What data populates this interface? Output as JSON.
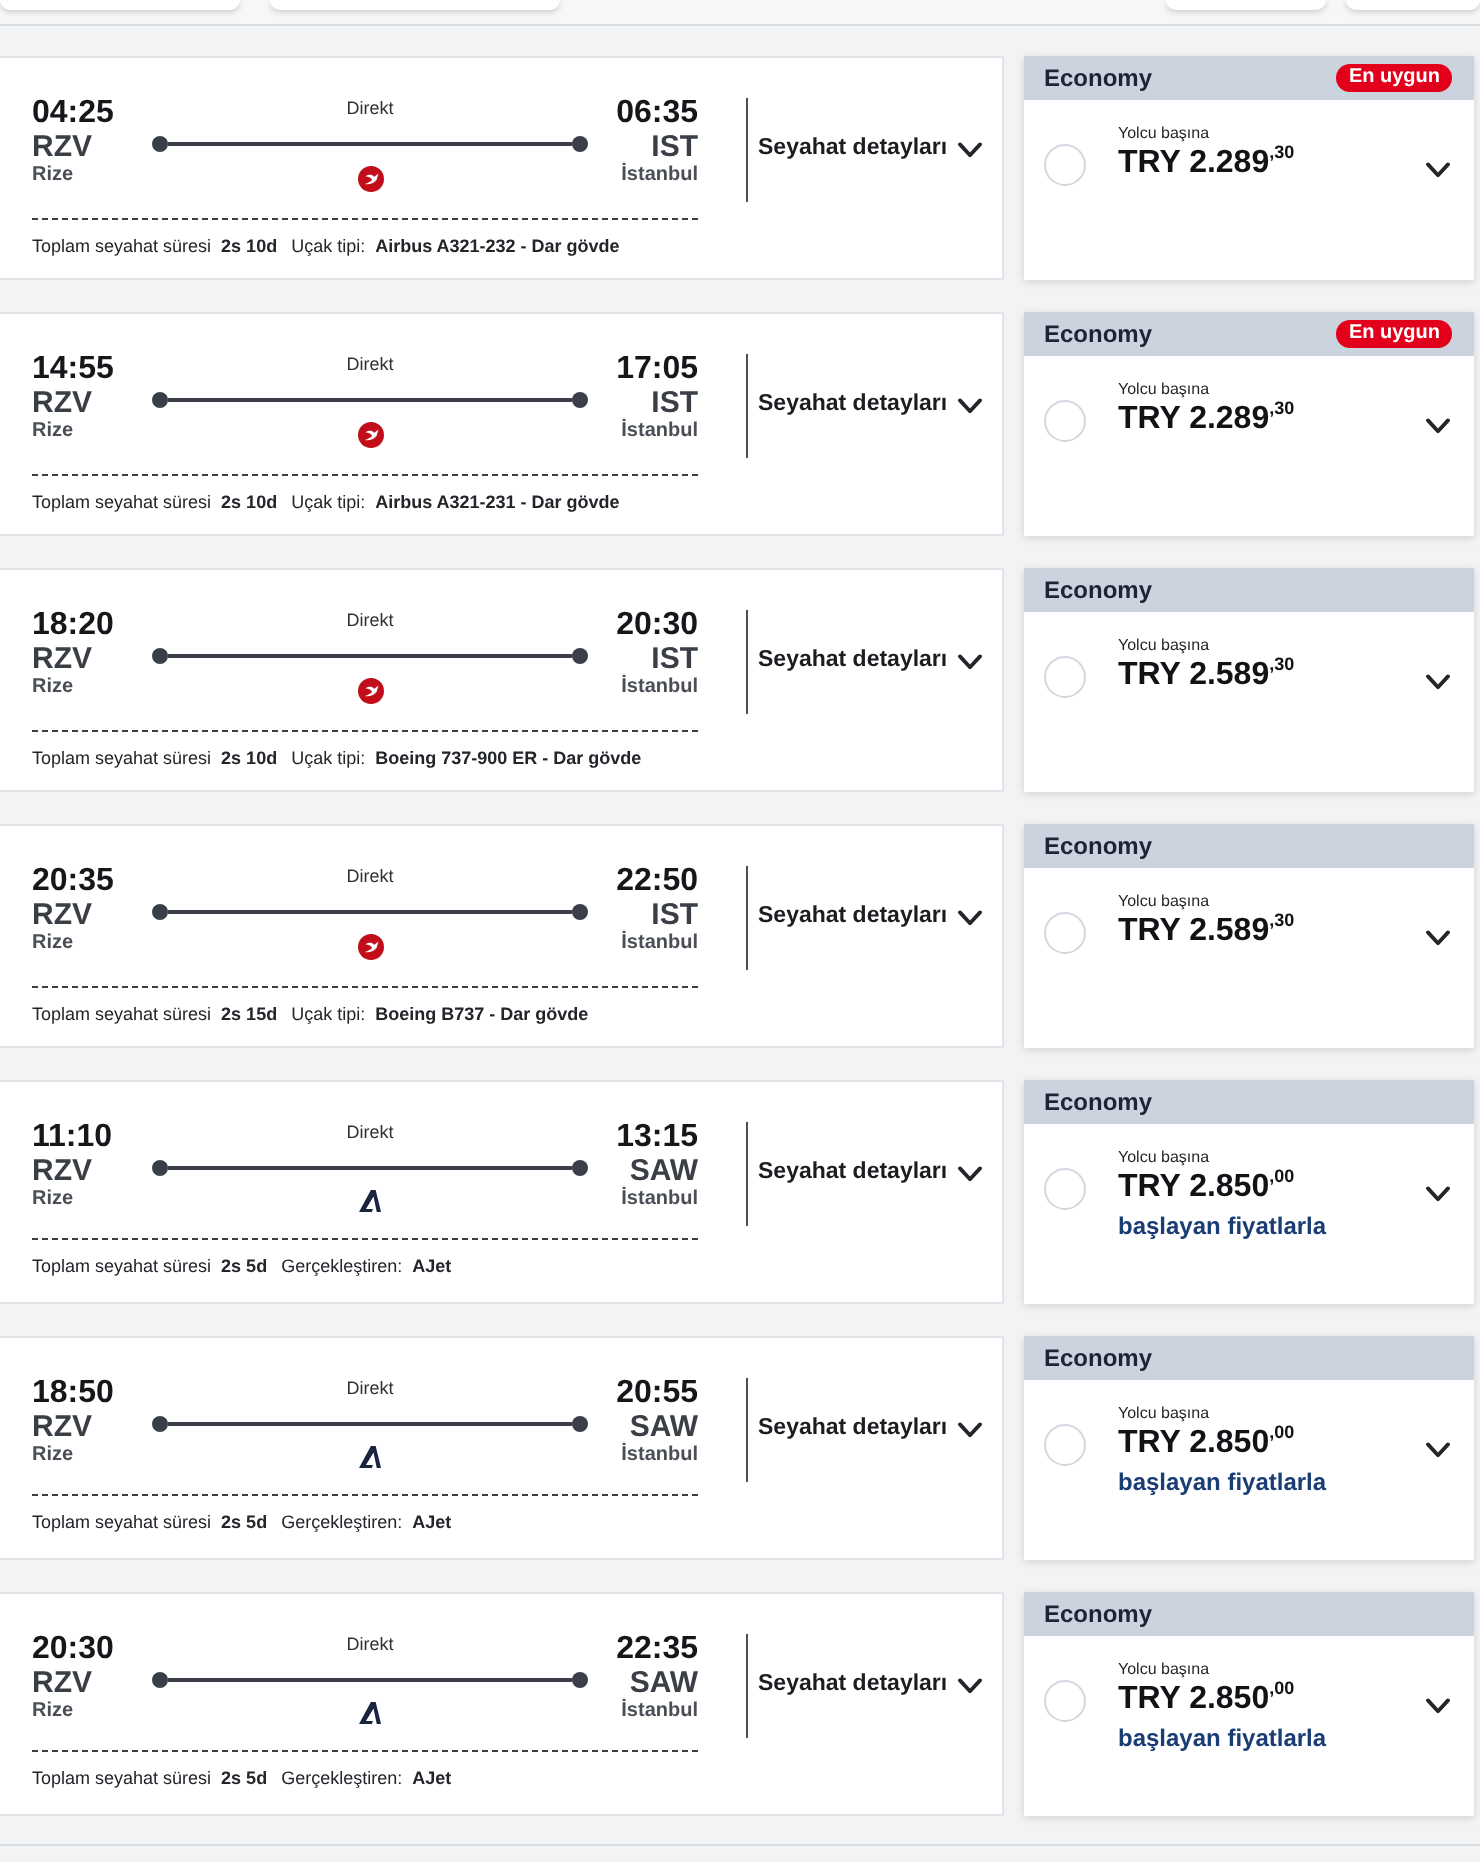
{
  "flights": [
    {
      "departure": {
        "time": "04:25",
        "code": "RZV",
        "city": "Rize"
      },
      "stop_label": "Direkt",
      "logo": {
        "kind": "disc"
      },
      "arrival": {
        "time": "06:35",
        "code": "IST",
        "city": "İstanbul"
      },
      "duration_label": "Toplam seyahat süresi",
      "duration": "2s 10d",
      "info_label": "Uçak tipi:",
      "info_value": "Airbus A321-232 - Dar gövde",
      "details_button": "Seyahat detayları",
      "fare": {
        "cabin": "Economy",
        "badge": "En uygun",
        "caption": "Yolcu başına",
        "price": "TRY 2.289$^{,30}$",
        "selected": false
      }
    },
    {
      "departure": {
        "time": "14:55",
        "code": "RZV",
        "city": "Rize"
      },
      "stop_label": "Direkt",
      "logo": {
        "kind": "disc"
      },
      "arrival": {
        "time": "17:05",
        "code": "IST",
        "city": "İstanbul"
      },
      "duration_label": "Toplam seyahat süresi",
      "duration": "2s 10d",
      "info_label": "Uçak tipi:",
      "info_value": "Airbus A321-231 - Dar gövde",
      "details_button": "Seyahat detayları",
      "fare": {
        "cabin": "Economy",
        "badge": "En uygun",
        "caption": "Yolcu başına",
        "price": "TRY 2.289$^{,30}$",
        "selected": false
      }
    },
    {
      "departure": {
        "time": "18:20",
        "code": "RZV",
        "city": "Rize"
      },
      "stop_label": "Direkt",
      "logo": {
        "kind": "disc"
      },
      "arrival": {
        "time": "20:30",
        "code": "IST",
        "city": "İstanbul"
      },
      "duration_label": "Toplam seyahat süresi",
      "duration": "2s 10d",
      "info_label": "Uçak tipi:",
      "info_value": "Boeing 737-900 ER - Dar gövde",
      "details_button": "Seyahat detayları",
      "fare": {
        "cabin": "Economy",
        "caption": "Yolcu başına",
        "price": "TRY 2.589$^{,30}$",
        "selected": false
      }
    },
    {
      "departure": {
        "time": "20:35",
        "code": "RZV",
        "city": "Rize"
      },
      "stop_label": "Direkt",
      "logo": {
        "kind": "disc"
      },
      "arrival": {
        "time": "22:50",
        "code": "IST",
        "city": "İstanbul"
      },
      "duration_label": "Toplam seyahat süresi",
      "duration": "2s 15d",
      "info_label": "Uçak tipi:",
      "info_value": "Boeing B737 - Dar gövde",
      "details_button": "Seyahat detayları",
      "fare": {
        "cabin": "Economy",
        "caption": "Yolcu başına",
        "price": "TRY 2.589$^{,30}$",
        "selected": false
      }
    },
    {
      "departure": {
        "time": "11:10",
        "code": "RZV",
        "city": "Rize"
      },
      "stop_label": "Direkt",
      "logo": {
        "kind": "letter"
      },
      "arrival": {
        "time": "13:15",
        "code": "SAW",
        "city": "İstanbul"
      },
      "duration_label": "Toplam seyahat süresi",
      "duration": "2s 5d",
      "info_label": "Gerçekleştiren:",
      "info_value": "AJet",
      "details_button": "Seyahat detayları",
      "fare": {
        "cabin": "Economy",
        "caption": "Yolcu başına",
        "price": "TRY 2.850$^{,00}$",
        "note": "başlayan fiyatlarla",
        "selected": false
      }
    },
    {
      "departure": {
        "time": "18:50",
        "code": "RZV",
        "city": "Rize"
      },
      "stop_label": "Direkt",
      "logo": {
        "kind": "letter"
      },
      "arrival": {
        "time": "20:55",
        "code": "SAW",
        "city": "İstanbul"
      },
      "duration_label": "Toplam seyahat süresi",
      "duration": "2s 5d",
      "info_label": "Gerçekleştiren:",
      "info_value": "AJet",
      "details_button": "Seyahat detayları",
      "fare": {
        "cabin": "Economy",
        "caption": "Yolcu başına",
        "price": "TRY 2.850$^{,00}$",
        "note": "başlayan fiyatlarla",
        "selected": false
      }
    },
    {
      "departure": {
        "time": "20:30",
        "code": "RZV",
        "city": "Rize"
      },
      "stop_label": "Direkt",
      "logo": {
        "kind": "letter"
      },
      "arrival": {
        "time": "22:35",
        "code": "SAW",
        "city": "İstanbul"
      },
      "duration_label": "Toplam seyahat süresi",
      "duration": "2s 5d",
      "info_label": "Gerçekleştiren:",
      "info_value": "AJet",
      "details_button": "Seyahat detayları",
      "fare": {
        "cabin": "Economy",
        "caption": "Yolcu başına",
        "price": "TRY 2.850$^{,00}$",
        "note": "başlayan fiyatlarla",
        "selected": false
      }
    }
  ]
}
